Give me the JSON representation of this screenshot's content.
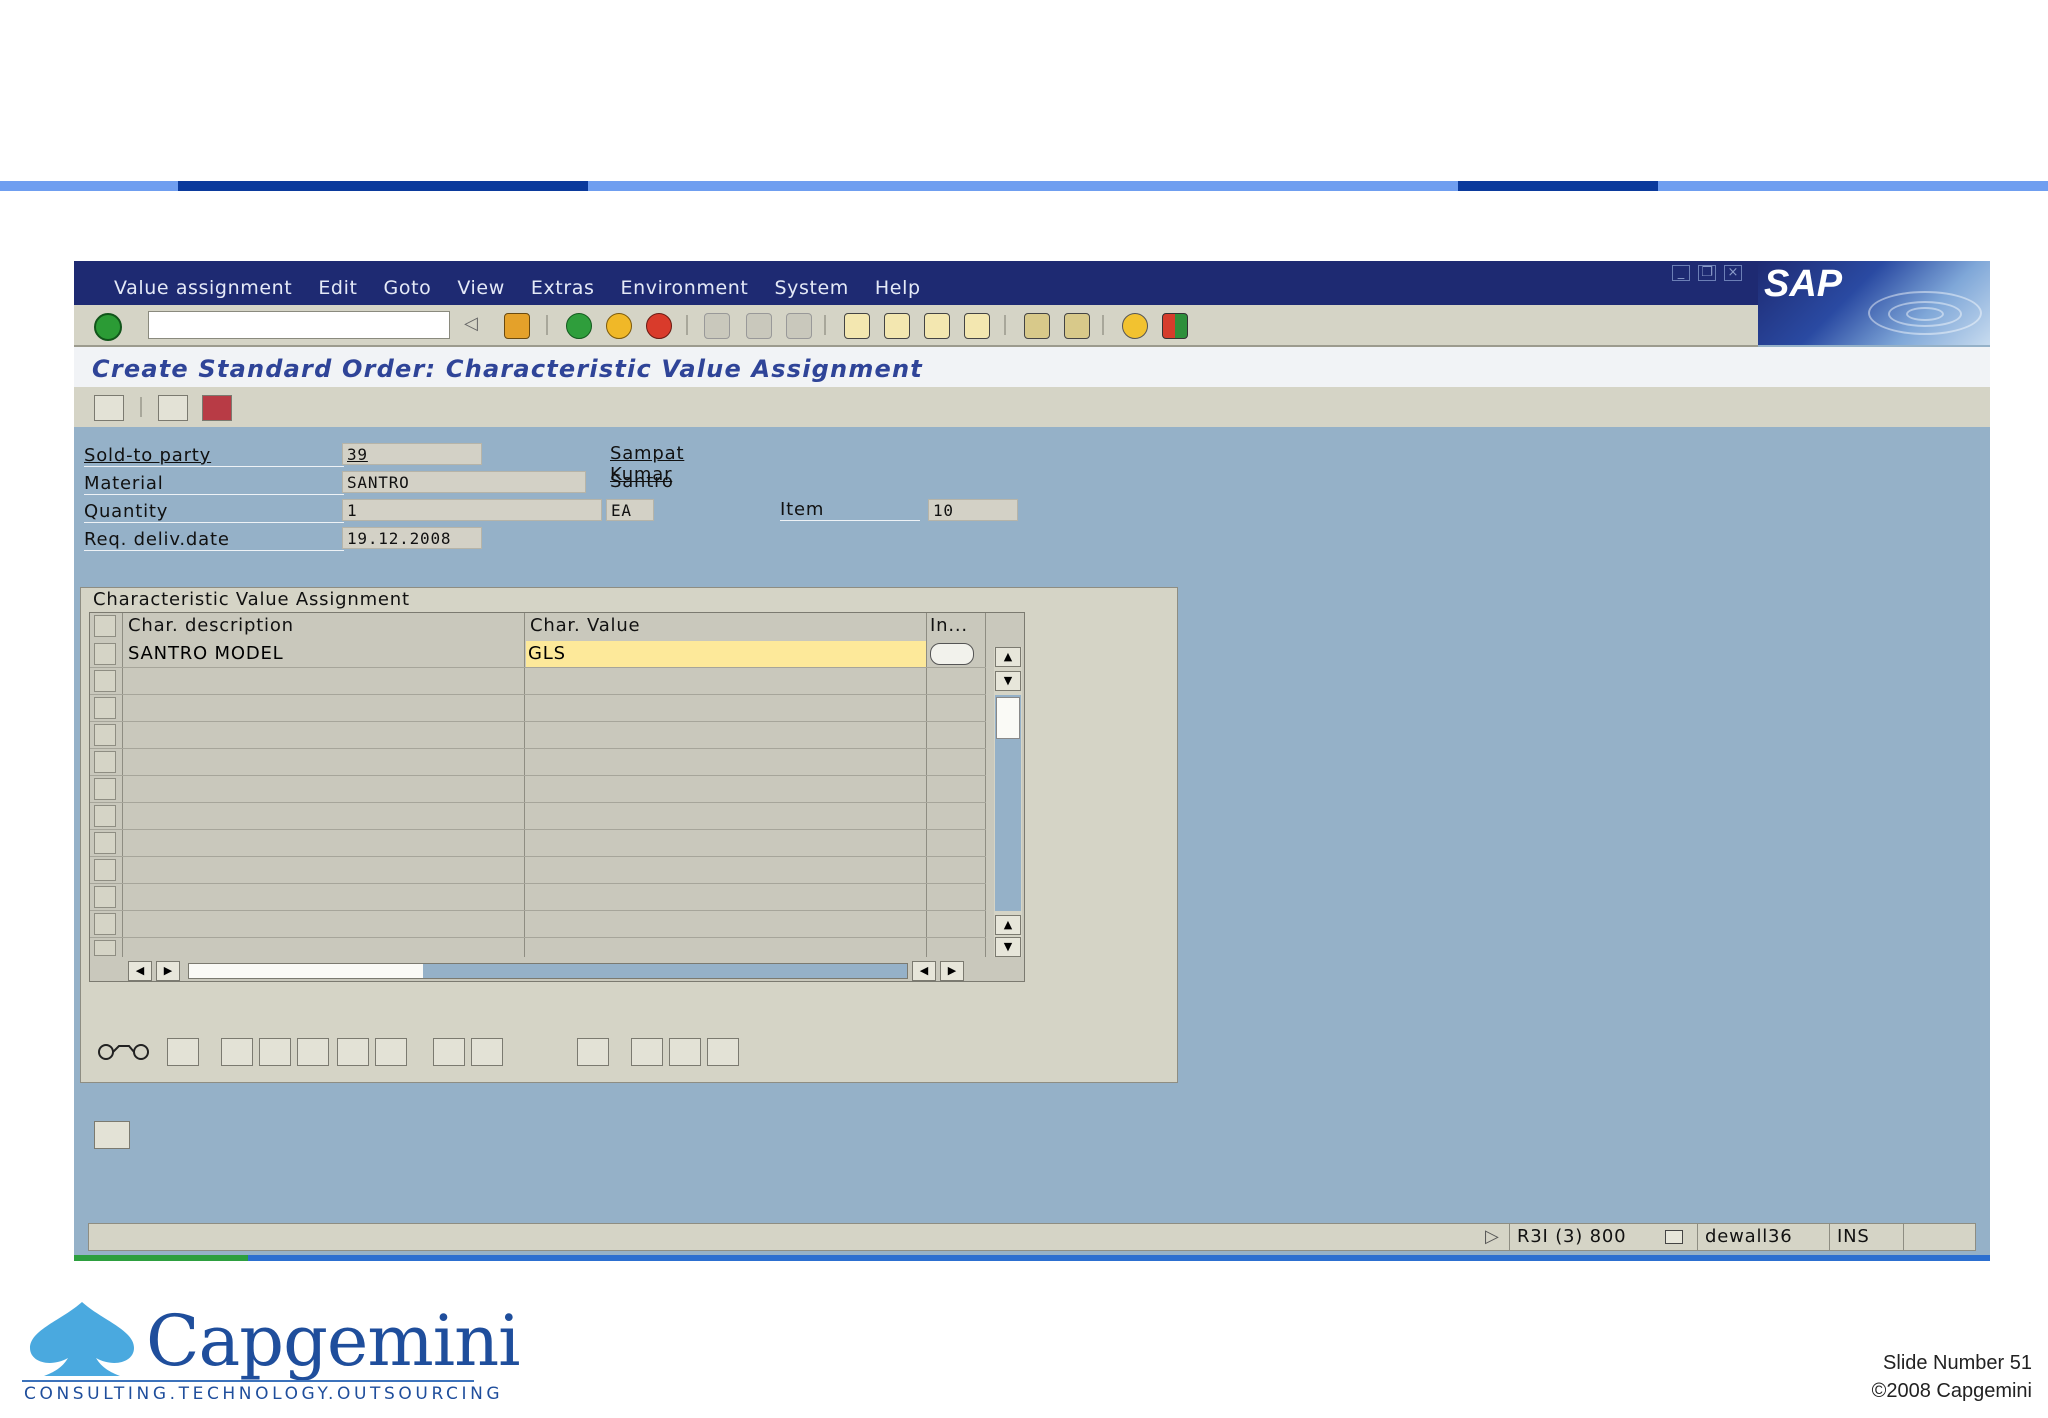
{
  "menu": [
    "Value assignment",
    "Edit",
    "Goto",
    "View",
    "Extras",
    "Environment",
    "System",
    "Help"
  ],
  "sap_logo": "SAP",
  "screen_title": "Create Standard Order: Characteristic Value Assignment",
  "header": {
    "sold_to": {
      "label": "Sold-to party",
      "value": "39",
      "name": "Sampat Kumar"
    },
    "material": {
      "label": "Material",
      "value": "SANTRO",
      "description": "Santro"
    },
    "quantity": {
      "label": "Quantity",
      "value": "1",
      "unit": "EA"
    },
    "item": {
      "label": "Item",
      "value": "10"
    },
    "req_deliv": {
      "label": "Req. deliv.date",
      "value": "19.12.2008"
    }
  },
  "tab": {
    "title": "Characteristic Value Assignment"
  },
  "grid": {
    "columns": [
      "Char. description",
      "Char. Value",
      "In..."
    ],
    "rows": [
      {
        "description": "SANTRO MODEL",
        "value": "GLS"
      }
    ]
  },
  "status": {
    "system": "R3I (3) 800",
    "user": "dewall36",
    "mode": "INS"
  },
  "footer": {
    "brand": "Capgemini",
    "tagline": "CONSULTING.TECHNOLOGY.OUTSOURCING",
    "slide_number": "Slide Number 51",
    "copyright": "©2008 Capgemini"
  },
  "colors": {
    "sap_blue": "#1e2a72",
    "workarea": "#95b1c8",
    "highlight_field": "#fde99a",
    "stripe_light": "#6f9ef0",
    "stripe_dark": "#0b3a9c"
  }
}
